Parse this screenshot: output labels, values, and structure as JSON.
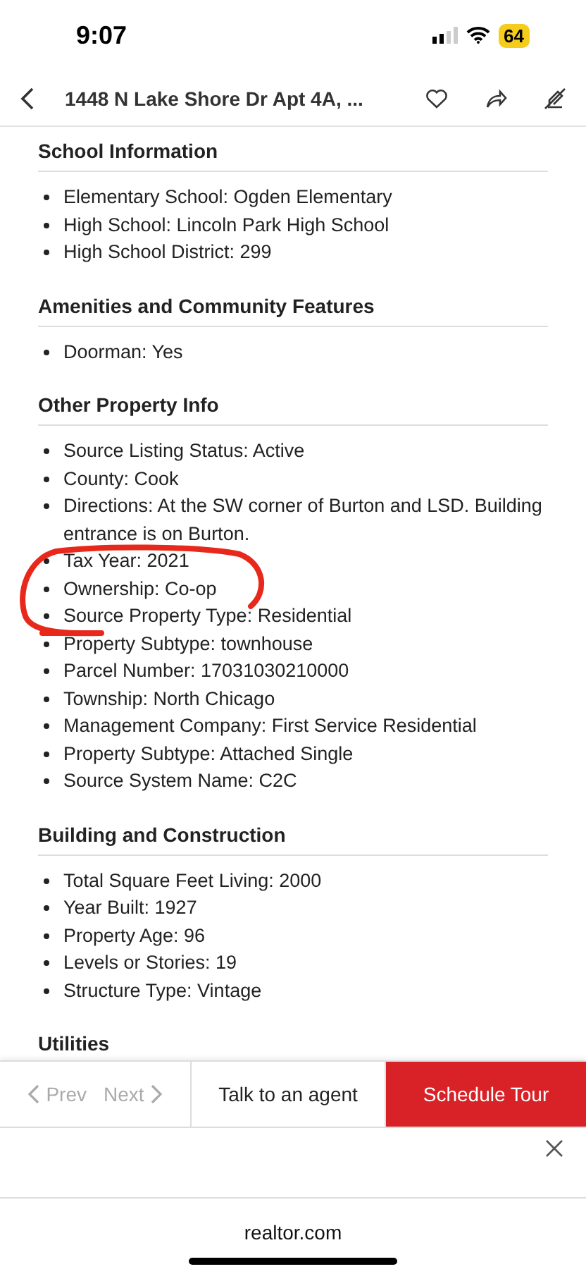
{
  "status_bar": {
    "time": "9:07",
    "battery": "64"
  },
  "nav": {
    "title": "1448 N Lake Shore Dr Apt 4A, ..."
  },
  "sections": [
    {
      "heading": "School Information",
      "items": [
        "Elementary School: Ogden Elementary",
        "High School: Lincoln Park High School",
        "High School District: 299"
      ]
    },
    {
      "heading": "Amenities and Community Features",
      "items": [
        "Doorman: Yes"
      ]
    },
    {
      "heading": "Other Property Info",
      "items": [
        "Source Listing Status: Active",
        "County: Cook",
        "Directions: At the SW corner of Burton and LSD. Building entrance is on Burton.",
        "Tax Year: 2021",
        "Ownership: Co-op",
        "Source Property Type: Residential",
        "Property Subtype: townhouse",
        "Parcel Number: 17031030210000",
        "Township: North Chicago",
        "Management Company: First Service Residential",
        "Property Subtype: Attached Single",
        "Source System Name: C2C"
      ]
    },
    {
      "heading": "Building and Construction",
      "items": [
        "Total Square Feet Living: 2000",
        "Year Built: 1927",
        "Property Age: 96",
        "Levels or Stories: 19",
        "Structure Type: Vintage"
      ]
    },
    {
      "heading": "Utilities"
    }
  ],
  "bottom_bar": {
    "prev": {
      "label": "Prev",
      "disabled": true
    },
    "next": {
      "label": "Next",
      "disabled": true
    },
    "agent_button": "Talk to an agent",
    "tour_button": "Schedule Tour"
  },
  "browser": {
    "url": "realtor.com"
  }
}
